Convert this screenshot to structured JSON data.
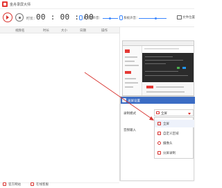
{
  "app": {
    "title": "金舟录屏大师"
  },
  "toolbar": {
    "duration_label": "时长：",
    "timer": "00 : 00 : 00",
    "mic_label": "麦克风声音：",
    "system_label": "系统声音：",
    "output_label": "文件位置"
  },
  "table": {
    "columns": [
      "视频名",
      "时长",
      "大小",
      "日期",
      "操作"
    ]
  },
  "bottom": {
    "website": "官方网站",
    "feedback": "在线客服"
  },
  "settings": {
    "title": "录屏设置",
    "mode_label": "录制模式",
    "audio_input_label": "音频输入",
    "mode_selected": "全屏",
    "options": [
      {
        "label": "全屏",
        "icon": "monitor-icon"
      },
      {
        "label": "自定义区域",
        "icon": "region-icon"
      },
      {
        "label": "摄像头",
        "icon": "camera-icon"
      },
      {
        "label": "分屏录制",
        "icon": "split-screen-icon"
      }
    ]
  },
  "colors": {
    "accent": "#d8332f",
    "header_blue": "#3b6cc4",
    "slider_blue": "#3a86ff"
  }
}
